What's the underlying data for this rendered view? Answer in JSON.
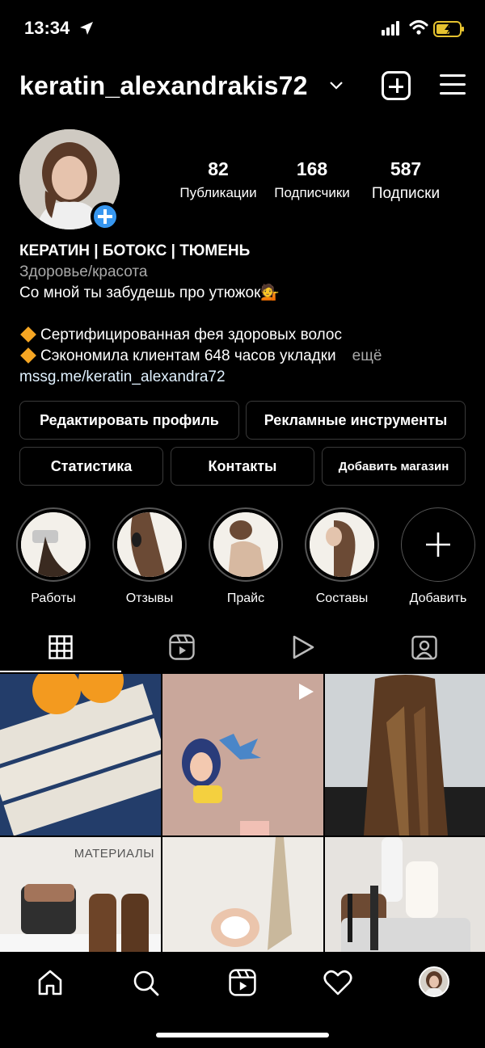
{
  "status_bar": {
    "time": "13:34"
  },
  "header": {
    "username": "keratin_alexandrakis72"
  },
  "stats": [
    {
      "value": "82",
      "label": "Публикации"
    },
    {
      "value": "168",
      "label": "Подписчики"
    },
    {
      "value": "587",
      "label": "Подписки"
    }
  ],
  "bio": {
    "name": "КЕРАТИН | БОТОКС | ТЮМЕНЬ",
    "category": "Здоровье/красота",
    "line1": "Со мной ты забудешь про утюжок💁",
    "line2": "Сертифицированная фея здоровых волос",
    "line3": "Сэкономила клиентам 648 часов укладки",
    "more": "ещё",
    "link": "mssg.me/keratin_alexandra72"
  },
  "buttons": {
    "edit_profile": "Редактировать профиль",
    "ad_tools": "Рекламные инструменты",
    "insights": "Статистика",
    "contacts": "Контакты",
    "add_shop": "Добавить магазин"
  },
  "highlights": [
    {
      "label": "Работы"
    },
    {
      "label": "Отзывы"
    },
    {
      "label": "Прайс"
    },
    {
      "label": "Составы"
    },
    {
      "label": "Добавить"
    }
  ],
  "grid": {
    "post5_caption": "МАТЕРИАЛЫ"
  },
  "colors": {
    "accent": "#3797f0",
    "background": "#000000",
    "border": "#3a3a3a"
  }
}
